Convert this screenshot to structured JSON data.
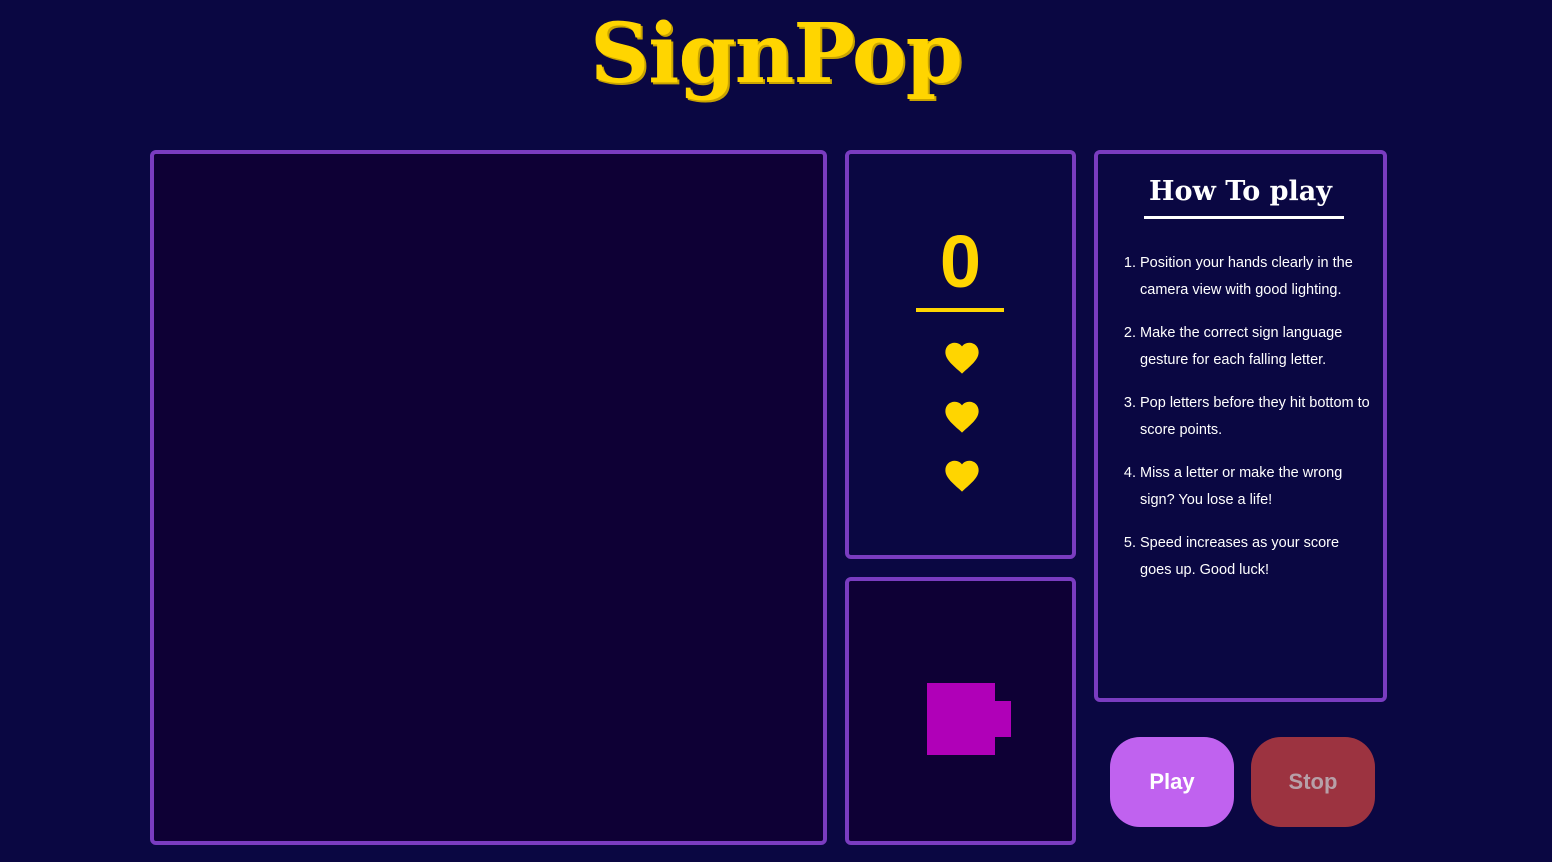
{
  "app": {
    "title": "SignPop"
  },
  "score": {
    "value": "0",
    "lives": 3
  },
  "howto": {
    "title": "How To play",
    "steps": [
      "Position your hands clearly in the camera view with good lighting.",
      "Make the correct sign language gesture for each falling letter.",
      "Pop letters before they hit bottom to score points.",
      "Miss a letter or make the wrong sign? You lose a life!",
      "Speed increases as your score goes up. Good luck!"
    ]
  },
  "controls": {
    "play_label": "Play",
    "stop_label": "Stop"
  },
  "icons": {
    "life": "heart-icon",
    "camera": "video-camera-icon"
  },
  "colors": {
    "background": "#0a0742",
    "accent": "#ffd500",
    "panel_border": "#7a3cc0",
    "play": "#c062ef",
    "stop": "#9c3340",
    "camera_icon": "#b000b8"
  }
}
